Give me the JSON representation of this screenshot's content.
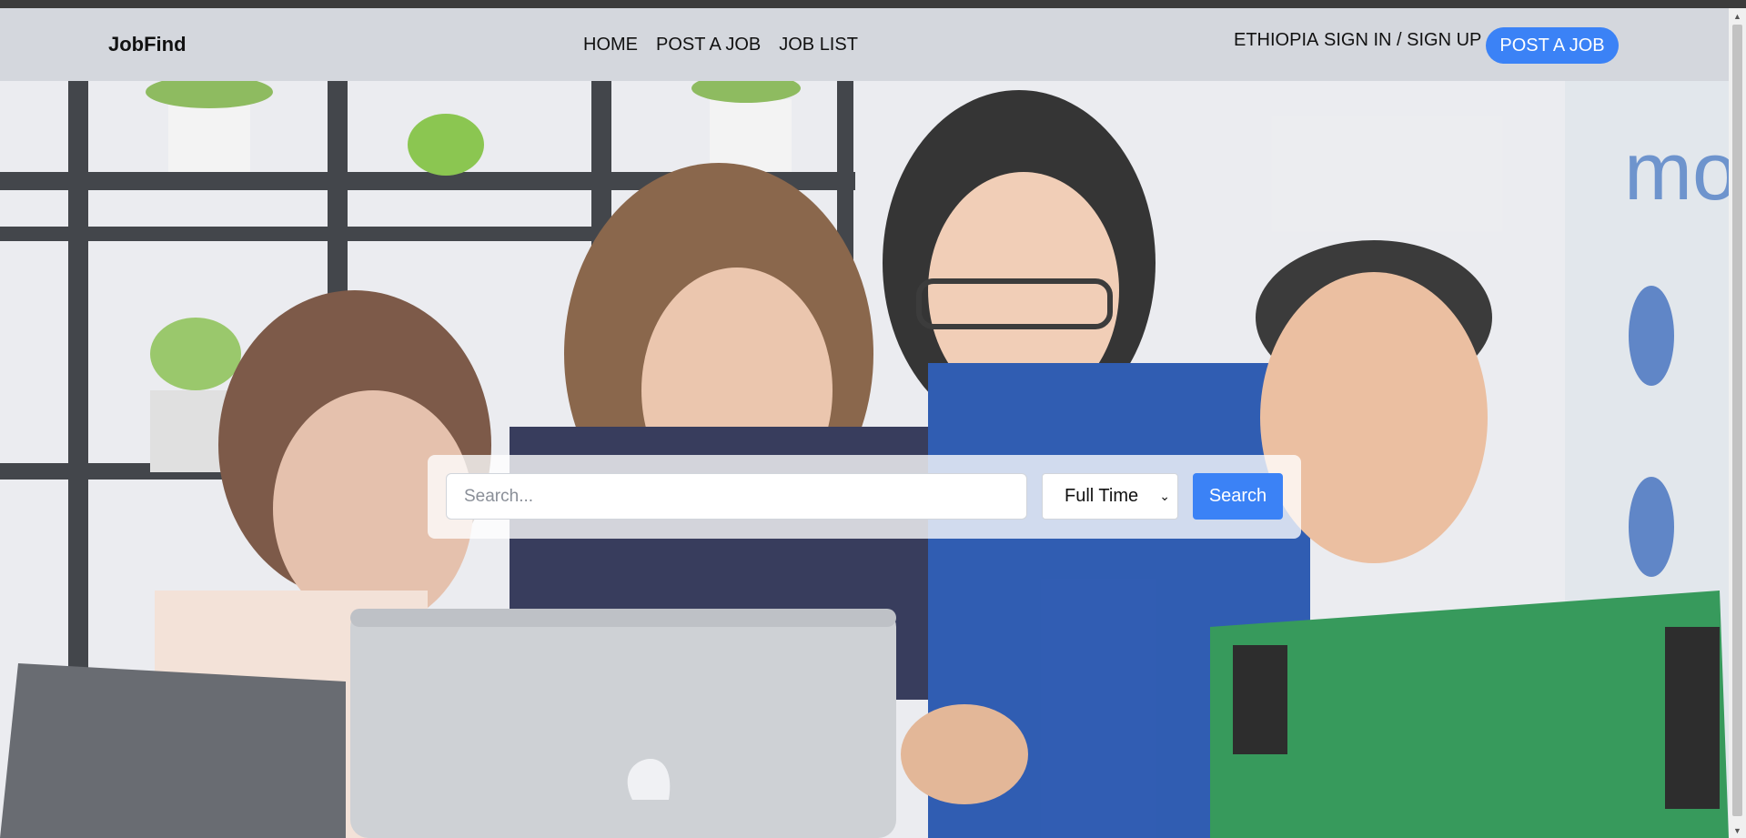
{
  "nav": {
    "brand": "JobFind",
    "links": [
      "HOME",
      "POST A JOB",
      "JOB LIST"
    ],
    "country": "ETHIOPIA",
    "auth": "SIGN IN / SIGN UP",
    "cta": "POST A JOB"
  },
  "hero": {
    "image_description_icon": "team-photo",
    "search": {
      "placeholder": "Search...",
      "value": "",
      "job_type": "Full Time",
      "button": "Search"
    }
  },
  "colors": {
    "accent": "#3b82f6",
    "navbar": "#d4d7dd"
  }
}
